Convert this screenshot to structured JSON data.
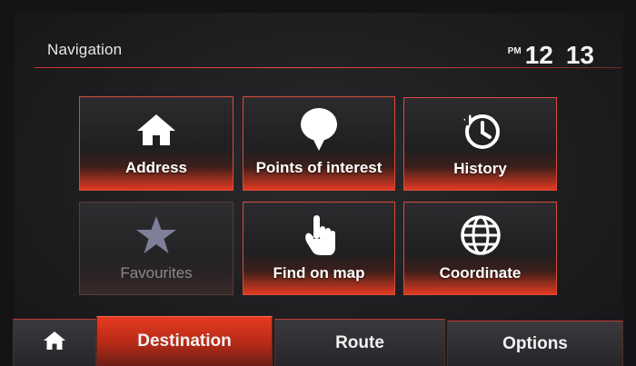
{
  "header": {
    "title": "Navigation",
    "clock": {
      "ampm": "PM",
      "hour": "12",
      "minute": "13"
    }
  },
  "tiles": [
    {
      "label": "Address",
      "icon": "home-icon",
      "enabled": true
    },
    {
      "label": "Points of interest",
      "icon": "map-pin-icon",
      "enabled": true
    },
    {
      "label": "History",
      "icon": "history-icon",
      "enabled": true
    },
    {
      "label": "Favourites",
      "icon": "star-icon",
      "enabled": false
    },
    {
      "label": "Find on map",
      "icon": "hand-pointer-icon",
      "enabled": true
    },
    {
      "label": "Coordinate",
      "icon": "globe-icon",
      "enabled": true
    }
  ],
  "tabs": [
    {
      "label": "",
      "icon": "home-icon",
      "active": false
    },
    {
      "label": "Destination",
      "active": true
    },
    {
      "label": "Route",
      "active": false
    },
    {
      "label": "Options",
      "active": false
    }
  ],
  "colors": {
    "accent": "#e23a22",
    "tile_border": "#d84a3c",
    "disabled_text": "#8a8a92"
  }
}
